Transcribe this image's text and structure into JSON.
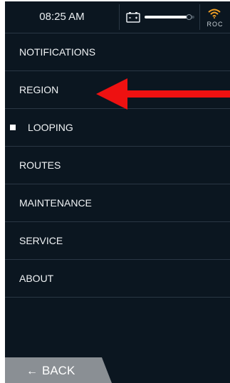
{
  "status_bar": {
    "time": "08:25 AM",
    "battery_icon": "battery-icon",
    "slider_level": 0.85,
    "wifi_icon": "wifi-icon",
    "network_label": "ROC",
    "wifi_color": "#f2a024"
  },
  "menu": {
    "items": [
      {
        "label": "NOTIFICATIONS"
      },
      {
        "label": "REGION"
      },
      {
        "label": "LOOPING",
        "selected": true
      },
      {
        "label": "ROUTES"
      },
      {
        "label": "MAINTENANCE"
      },
      {
        "label": "SERVICE"
      },
      {
        "label": "ABOUT"
      }
    ]
  },
  "annotation": {
    "arrow_color": "#ee1111",
    "arrow_points_to": "REGION"
  },
  "back": {
    "arrow_glyph": "←",
    "label": "BACK",
    "bg_color": "#8a8f94"
  }
}
